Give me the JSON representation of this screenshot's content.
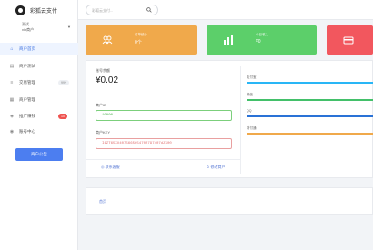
{
  "brand": {
    "name": "彩狐云支付"
  },
  "user": {
    "name": "测试",
    "role": "vip商户"
  },
  "search": {
    "placeholder": "彩狐云支付..."
  },
  "sidebar": {
    "items": [
      {
        "label": "商户首页",
        "icon": "home-icon",
        "active": true
      },
      {
        "label": "商户测试",
        "icon": "doc-icon"
      },
      {
        "label": "交易管理",
        "icon": "list-icon",
        "badge": "99+"
      },
      {
        "label": "商户管理",
        "icon": "shop-icon"
      },
      {
        "label": "推广赚钱",
        "icon": "share-icon",
        "badge": "10"
      },
      {
        "label": "账号中心",
        "icon": "user-icon"
      }
    ],
    "cta": "商户公告"
  },
  "stats": [
    {
      "title": "订单统计",
      "value": "0个",
      "color": "#f0a94b",
      "icon": "users-icon"
    },
    {
      "title": "今日收入",
      "value": "¥0",
      "color": "#5ccf6a",
      "icon": "chart-icon"
    },
    {
      "title": "",
      "value": "",
      "color": "#f2575e",
      "icon": "card-icon"
    }
  ],
  "account": {
    "balance_label": "账号余额",
    "balance": "¥0.02",
    "pid_label": "商户ID",
    "pid": "10000",
    "key_label": "商户KEY",
    "key": "I1ZT65XU4075665654702797407dZ500",
    "action_left": "联系客服",
    "action_right": "修改商户"
  },
  "channels": [
    {
      "label": "支付宝",
      "color": "#29b6f6"
    },
    {
      "label": "微信",
      "color": "#43c06a"
    },
    {
      "label": "QQ",
      "color": "#2a72d6"
    },
    {
      "label": "财付通",
      "color": "#f0a94b"
    }
  ],
  "bottom": {
    "link": "首页"
  }
}
